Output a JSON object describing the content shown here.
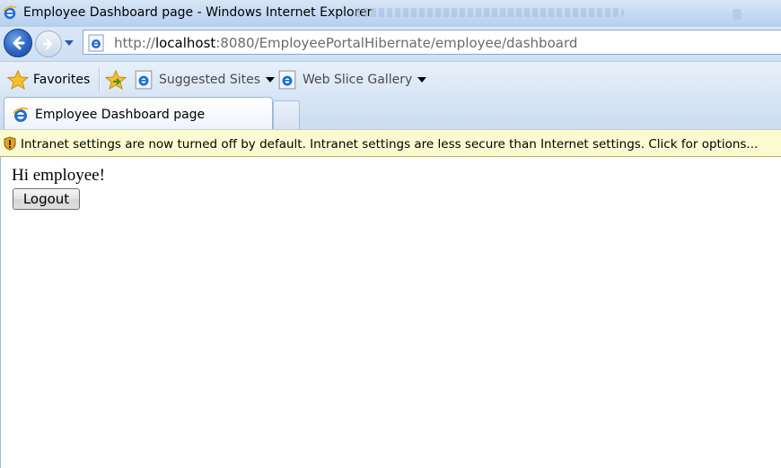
{
  "window": {
    "title": "Employee Dashboard page - Windows Internet Explorer"
  },
  "address": {
    "url_prefix": "http://",
    "url_host": "localhost",
    "url_rest": ":8080/EmployeePortalHibernate/employee/dashboard"
  },
  "favorites_bar": {
    "favorites_label": "Favorites",
    "items": [
      {
        "label": "Suggested Sites"
      },
      {
        "label": "Web Slice Gallery"
      }
    ]
  },
  "tabs": [
    {
      "label": "Employee Dashboard page",
      "active": true
    }
  ],
  "info_bar": {
    "message": "Intranet settings are now turned off by default. Intranet settings are less secure than Internet settings. Click for options..."
  },
  "page": {
    "greeting": "Hi employee!",
    "logout_label": "Logout"
  },
  "colors": {
    "ie_blue": "#2a64c4",
    "info_bar_bg": "#fbfbd2",
    "chrome_bg": "#cfe0f4"
  }
}
